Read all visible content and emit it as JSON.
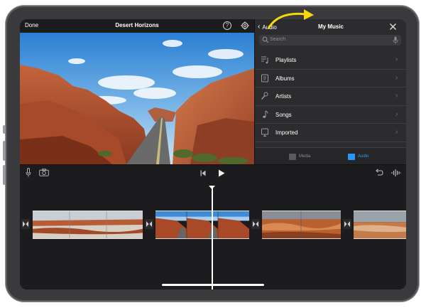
{
  "editor": {
    "done_label": "Done",
    "project_title": "Desert Horizons"
  },
  "music_panel": {
    "back_label": "Audio",
    "title": "My Music",
    "search_placeholder": "Search",
    "items": [
      {
        "label": "Playlists",
        "icon": "playlist-icon"
      },
      {
        "label": "Albums",
        "icon": "album-icon"
      },
      {
        "label": "Artists",
        "icon": "artist-icon"
      },
      {
        "label": "Songs",
        "icon": "song-icon"
      },
      {
        "label": "Imported",
        "icon": "imported-icon"
      }
    ],
    "tabs": [
      {
        "label": "Media",
        "active": false
      },
      {
        "label": "Audio",
        "active": true
      }
    ]
  },
  "colors": {
    "accent": "#2997ff",
    "annotation_arrow": "#f5d90a",
    "background": "#1c1c1e",
    "panel": "#2c2c2e"
  }
}
